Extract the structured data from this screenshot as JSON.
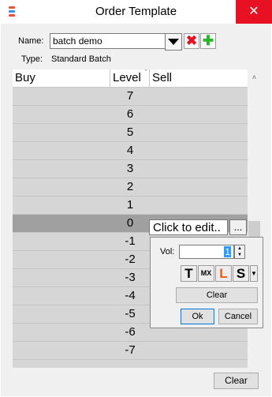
{
  "window": {
    "title": "Order Template",
    "close_glyph": "✕",
    "app_icon": "app-icon"
  },
  "form": {
    "name_label": "Name:",
    "name_value": "batch demo",
    "type_label": "Type:",
    "type_value": "Standard Batch",
    "delete_icon": "✖",
    "add_icon": "✚",
    "delete_color": "#e81123",
    "add_color": "#2bb52b"
  },
  "grid": {
    "columns": [
      "Buy",
      "Level",
      "Sell"
    ],
    "sort_glyph": "ˇ",
    "rows": [
      {
        "buy": "",
        "level": "7",
        "sell": ""
      },
      {
        "buy": "",
        "level": "6",
        "sell": ""
      },
      {
        "buy": "",
        "level": "5",
        "sell": ""
      },
      {
        "buy": "",
        "level": "4",
        "sell": ""
      },
      {
        "buy": "",
        "level": "3",
        "sell": ""
      },
      {
        "buy": "",
        "level": "2",
        "sell": ""
      },
      {
        "buy": "",
        "level": "1",
        "sell": ""
      },
      {
        "buy": "",
        "level": "0",
        "sell": "",
        "selected": true
      },
      {
        "buy": "",
        "level": "-1",
        "sell": ""
      },
      {
        "buy": "",
        "level": "-2",
        "sell": ""
      },
      {
        "buy": "",
        "level": "-3",
        "sell": ""
      },
      {
        "buy": "",
        "level": "-4",
        "sell": ""
      },
      {
        "buy": "",
        "level": "-5",
        "sell": ""
      },
      {
        "buy": "",
        "level": "-6",
        "sell": ""
      },
      {
        "buy": "",
        "level": "-7",
        "sell": ""
      }
    ],
    "edit_placeholder": "Click to edit..",
    "edit_button": "..."
  },
  "popup": {
    "vol_label": "Vol:",
    "vol_value": "1",
    "icons": [
      "T",
      "MX",
      "L",
      "S"
    ],
    "icon_l_color": "#e85d1a",
    "clear_label": "Clear",
    "ok_label": "Ok",
    "cancel_label": "Cancel"
  },
  "scroll": {
    "up": "˄",
    "down": "˅"
  },
  "footer": {
    "clear_label": "Clear"
  }
}
